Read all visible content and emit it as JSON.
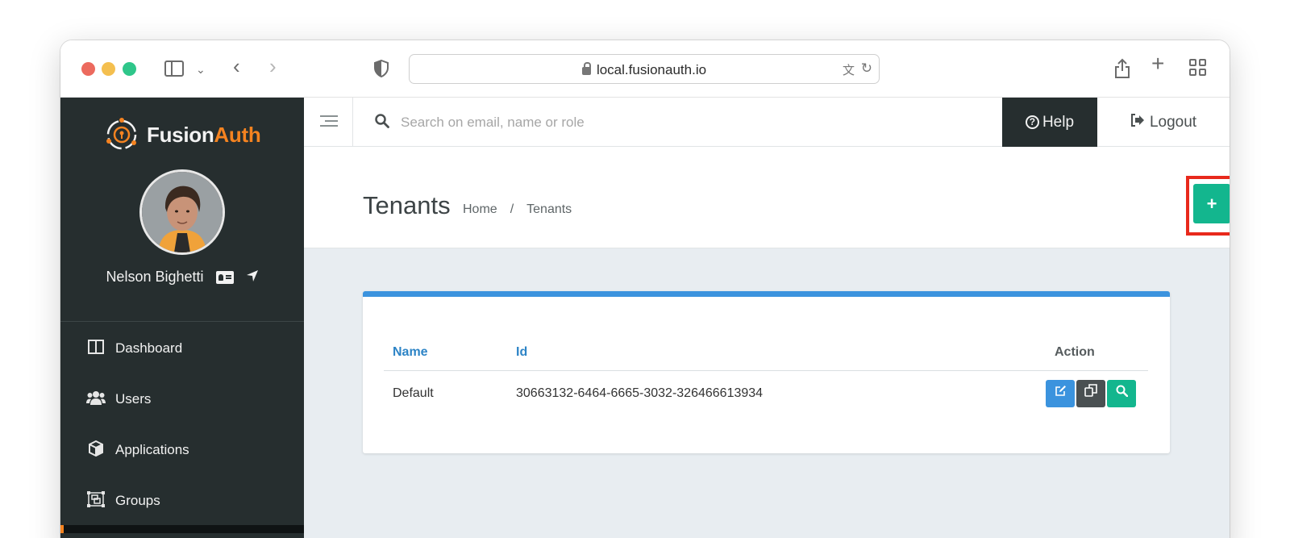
{
  "browser": {
    "url": "local.fusionauth.io"
  },
  "sidebar": {
    "logo": {
      "part1": "Fusion",
      "part2": "Auth"
    },
    "user_name": "Nelson Bighetti",
    "items": [
      {
        "label": "Dashboard",
        "icon": "columns-icon"
      },
      {
        "label": "Users",
        "icon": "users-icon"
      },
      {
        "label": "Applications",
        "icon": "cube-icon"
      },
      {
        "label": "Groups",
        "icon": "object-group-icon"
      }
    ]
  },
  "topbar": {
    "search_placeholder": "Search on email, name or role",
    "help_label": "Help",
    "logout_label": "Logout"
  },
  "page": {
    "title": "Tenants",
    "breadcrumb": [
      "Home",
      "Tenants"
    ],
    "add_label": "+"
  },
  "table": {
    "columns": [
      "Name",
      "Id",
      "Action"
    ],
    "rows": [
      {
        "name": "Default",
        "id": "30663132-6464-6665-3032-326466613934"
      }
    ]
  },
  "colors": {
    "sidebar_bg": "#262e2f",
    "brand_orange": "#f58320",
    "accent_green": "#13b68e",
    "accent_blue": "#3b93de",
    "highlight_red": "#e8291c"
  }
}
